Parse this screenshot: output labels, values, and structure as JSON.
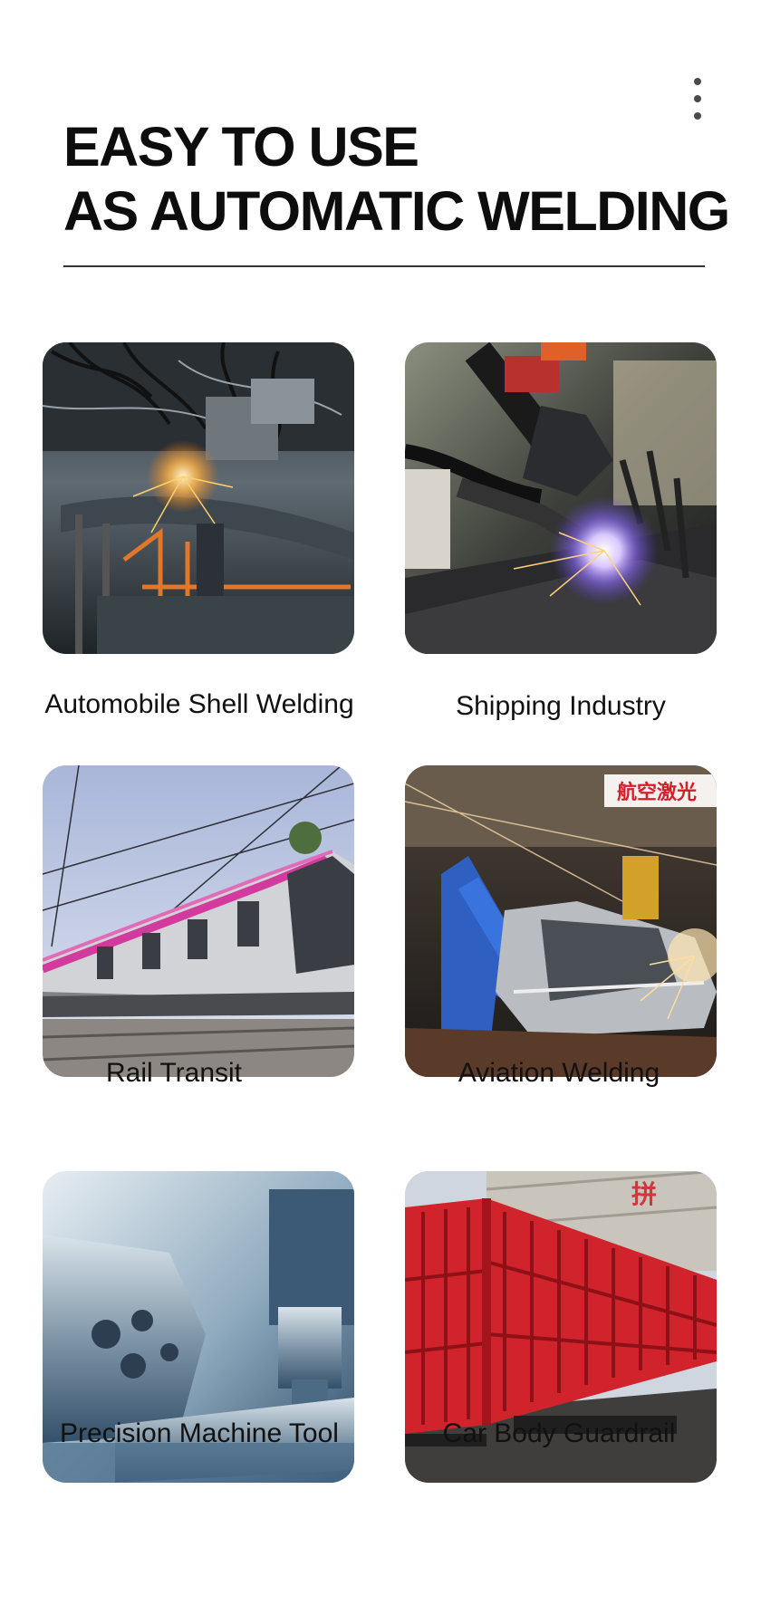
{
  "header": {
    "menu_icon": "more-vertical-icon",
    "title_line_1": "EASY TO USE",
    "title_line_2": "AS AUTOMATIC WELDING"
  },
  "applications": [
    {
      "label": "Automobile Shell Welding",
      "image": "automobile-welding-photo"
    },
    {
      "label": "Shipping Industry",
      "image": "robot-welding-sparks-photo"
    },
    {
      "label": "Rail Transit",
      "image": "metro-train-photo"
    },
    {
      "label": "Aviation Welding",
      "image": "robot-car-frame-welding-photo",
      "sign_text": "航空激光"
    },
    {
      "label": "Precision Machine Tool",
      "image": "cnc-machining-photo"
    },
    {
      "label": "Car Body Guardrail",
      "image": "red-truck-trailer-photo",
      "sign_text": "拼"
    }
  ]
}
